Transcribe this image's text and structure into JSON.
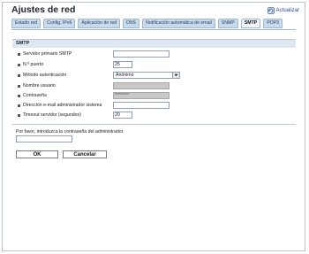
{
  "header": {
    "title": "Ajustes de red",
    "refresh_label": "Actualizar",
    "refresh_icon": "refresh-icon"
  },
  "tabs": [
    {
      "label": "Estado red",
      "active": false
    },
    {
      "label": "Config. IPv6",
      "active": false
    },
    {
      "label": "Aplicación de red",
      "active": false
    },
    {
      "label": "DNS",
      "active": false
    },
    {
      "label": "Notificación automática de email",
      "active": false
    },
    {
      "label": "SNMP",
      "active": false
    },
    {
      "label": "SMTP",
      "active": true
    },
    {
      "label": "POP3",
      "active": false
    }
  ],
  "section": {
    "title": "SMTP"
  },
  "fields": {
    "smtp_server": {
      "label": "Servidor primario SMTP",
      "value": ""
    },
    "port": {
      "label": "N.º puerto",
      "value": "25"
    },
    "auth_method": {
      "label": "Método autenticación",
      "value": "Anónimo"
    },
    "username": {
      "label": "Nombre usuario",
      "value": ""
    },
    "password": {
      "label": "Contraseña",
      "value": "********"
    },
    "admin_email": {
      "label": "Dirección e-mail administrador sistema",
      "value": ""
    },
    "timeout": {
      "label": "Timeout servidor (segundos)",
      "value": "20"
    }
  },
  "admin": {
    "prompt": "Por favor, introduzca la contraseña del administrador.",
    "value": ""
  },
  "buttons": {
    "ok": "OK",
    "cancel": "Cancelar"
  },
  "colors": {
    "tab_bg": "#c9dbea",
    "tab_active_bg": "#f4f7fb",
    "section_bg": "#dfe7f0",
    "disabled_field": "#c8c8c8"
  }
}
